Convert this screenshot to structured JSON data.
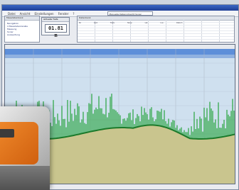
{
  "menu": {
    "items": [
      "Datei",
      "Ansicht",
      "Einstellungen",
      "Fenster",
      "?"
    ],
    "combo_value": "Manuelle Datenrohsicht Sonar"
  },
  "left_panel": {
    "title": "Messdatenbank",
    "rows": [
      "Navigation",
      "4 Messdatenkanäle",
      "Messung",
      "Sonar",
      "Auswertung"
    ]
  },
  "depth_popup": {
    "title": "Aktuelle Tiefe",
    "value": "01.81 m"
  },
  "data_table": {
    "title": "Datenbank",
    "columns": [
      "Nr",
      "Zeit",
      "Tiefe",
      "Temp",
      "Lat",
      "Lon",
      "Datum"
    ]
  },
  "chart_data": {
    "type": "area",
    "description_colors": {
      "water_top": "#5d8fd9",
      "water": "#cfe0ef",
      "vegetation": "#27a33d",
      "bottom_line": "#1b7a2b",
      "sediment": "#c9c58e"
    }
  }
}
